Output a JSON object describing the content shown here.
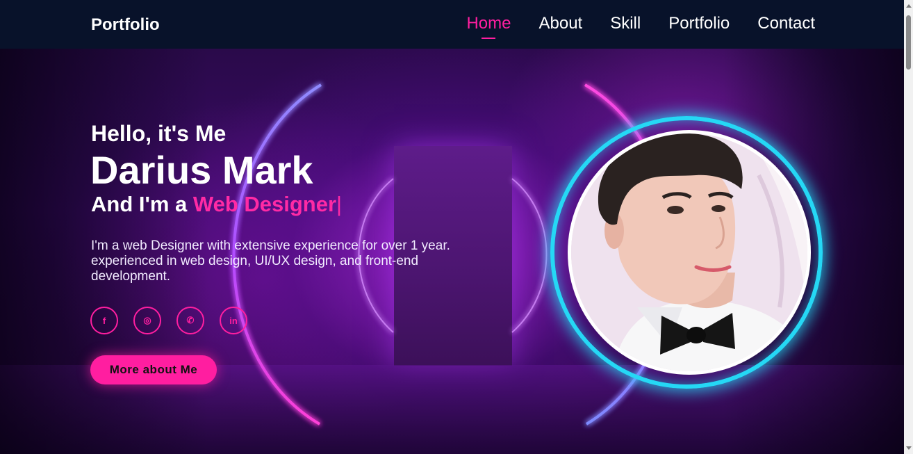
{
  "header": {
    "logo": "Portfolio",
    "nav": [
      {
        "label": "Home",
        "active": true
      },
      {
        "label": "About",
        "active": false
      },
      {
        "label": "Skill",
        "active": false
      },
      {
        "label": "Portfolio",
        "active": false
      },
      {
        "label": "Contact",
        "active": false
      }
    ]
  },
  "hero": {
    "greeting": "Hello, it's Me",
    "name": "Darius Mark",
    "role_prefix": "And I'm a ",
    "role_highlight": "Web Designer",
    "role_caret": "|",
    "bio": "I'm a web Designer with extensive experience for over 1 year. experienced in web design, UI/UX design, and front-end development.",
    "socials": [
      {
        "icon": "facebook-icon",
        "glyph": "f"
      },
      {
        "icon": "instagram-icon",
        "glyph": "◎"
      },
      {
        "icon": "whatsapp-icon",
        "glyph": "✆"
      },
      {
        "icon": "linkedin-icon",
        "glyph": "in"
      }
    ],
    "cta_label": "More about Me"
  },
  "colors": {
    "accent": "#ff1ea0",
    "ring": "#25d8f5",
    "header_bg": "#08122a"
  }
}
